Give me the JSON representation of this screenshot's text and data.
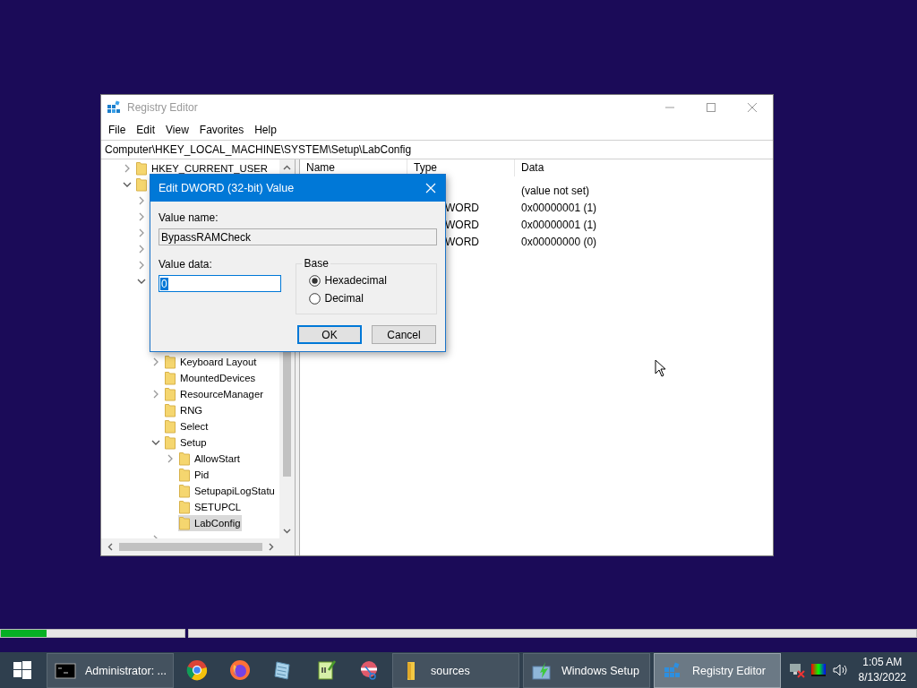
{
  "setup_progress": [
    {
      "level": 0.25
    },
    {
      "level": 0
    }
  ],
  "window": {
    "title": "Registry Editor",
    "active": false
  },
  "menu": [
    "File",
    "Edit",
    "View",
    "Favorites",
    "Help"
  ],
  "address": "Computer\\HKEY_LOCAL_MACHINE\\SYSTEM\\Setup\\LabConfig",
  "tree": [
    {
      "kind": "branch",
      "label": "HKEY_CURRENT_USER",
      "expanded": false,
      "selected": false
    },
    {
      "kind": "branch",
      "expanded": true,
      "children": [
        {
          "kind": "branch",
          "expanded": false
        },
        {
          "kind": "branch",
          "expanded": false
        },
        {
          "kind": "branch",
          "expanded": false
        },
        {
          "kind": "branch",
          "expanded": false
        },
        {
          "kind": "branch",
          "expanded": false
        },
        {
          "kind": "branch",
          "expanded": true,
          "children": [
            {
              "kind": "branch",
              "label": "Keyboard Layout",
              "expanded": false,
              "selected": false
            },
            {
              "kind": "leaf",
              "label": "MountedDevices",
              "selected": false
            },
            {
              "kind": "branch",
              "label": "ResourceManager",
              "expanded": false,
              "selected": false
            },
            {
              "kind": "leaf",
              "label": "RNG",
              "selected": false
            },
            {
              "kind": "leaf",
              "label": "Select",
              "selected": false
            },
            {
              "kind": "branch",
              "label": "Setup",
              "expanded": true,
              "selected": false,
              "children": [
                {
                  "kind": "branch",
                  "label": "AllowStart",
                  "expanded": false,
                  "selected": false
                },
                {
                  "kind": "leaf",
                  "label": "Pid",
                  "selected": false
                },
                {
                  "kind": "leaf",
                  "label": "SetupapiLogStatu",
                  "selected": false
                },
                {
                  "kind": "leaf",
                  "label": "SETUPCL",
                  "selected": false
                },
                {
                  "kind": "leaf",
                  "label": "LabConfig",
                  "selected": true
                }
              ]
            },
            {
              "kind": "branch",
              "expanded": false
            }
          ]
        }
      ]
    }
  ],
  "list": {
    "columns": [
      "Name",
      "Type",
      "Data"
    ],
    "rows": [
      {
        "data": "(value not set)"
      },
      {
        "type": "WORD",
        "data": "0x00000001 (1)"
      },
      {
        "type": "WORD",
        "data": "0x00000001 (1)"
      },
      {
        "type": "WORD",
        "data": "0x00000000 (0)"
      }
    ]
  },
  "dialog": {
    "title": "Edit DWORD (32-bit) Value",
    "value_name_label": "Value name:",
    "value_name": "BypassRAMCheck",
    "value_data_label": "Value data:",
    "value_data": "0",
    "base_label": "Base",
    "base_options": [
      {
        "label": "Hexadecimal",
        "selected": true
      },
      {
        "label": "Decimal",
        "selected": false
      }
    ],
    "buttons": [
      {
        "label": "OK",
        "default": true
      },
      {
        "label": "Cancel",
        "default": false
      }
    ]
  },
  "taskbar": {
    "items": [
      {
        "kind": "start"
      },
      {
        "kind": "window",
        "label": "Administrator: ...",
        "selected": false
      },
      {
        "kind": "pinned"
      },
      {
        "kind": "pinned"
      },
      {
        "kind": "pinned"
      },
      {
        "kind": "pinned"
      },
      {
        "kind": "pinned"
      },
      {
        "kind": "window",
        "label": "sources",
        "selected": false
      },
      {
        "kind": "window",
        "label": "Windows Setup",
        "selected": false
      },
      {
        "kind": "window",
        "label": "Registry Editor",
        "selected": true
      }
    ],
    "clock": {
      "time": "1:05 AM",
      "date": "8/13/2022"
    }
  }
}
